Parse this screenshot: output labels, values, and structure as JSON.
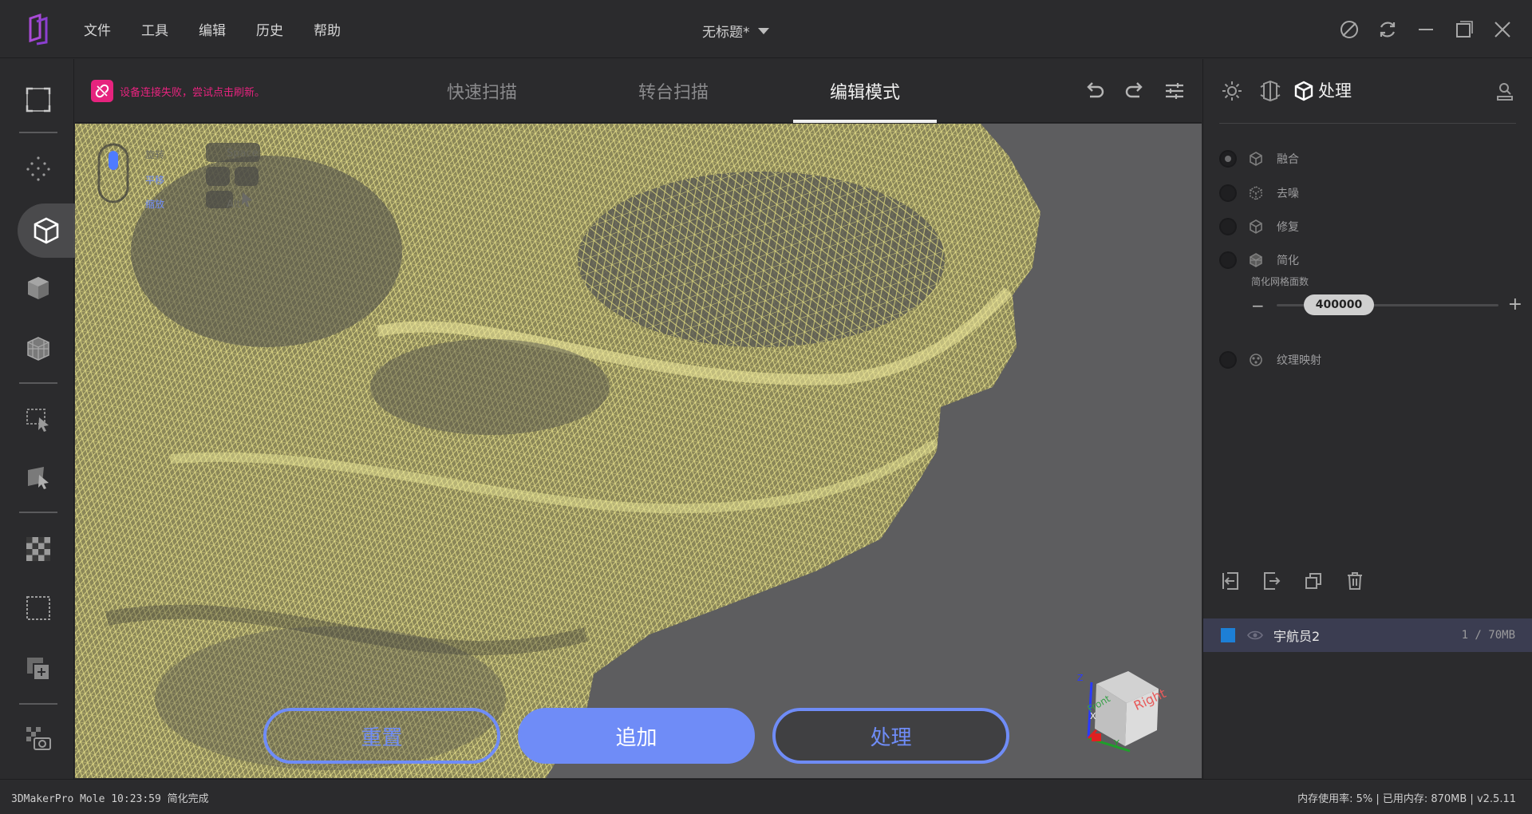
{
  "titlebar": {
    "menu": [
      "文件",
      "工具",
      "编辑",
      "历史",
      "帮助"
    ],
    "document_title": "无标题*"
  },
  "viewport_header": {
    "warning": "设备连接失败，尝试点击刷新。",
    "tabs": [
      "快速扫描",
      "转台扫描",
      "编辑模式"
    ],
    "active_tab": "编辑模式"
  },
  "hints": {
    "labels": [
      "旋转",
      "平移",
      "缩放"
    ],
    "keys": [
      "Space",
      "Alt"
    ]
  },
  "actions": {
    "reset": "重置",
    "append": "追加",
    "process": "处理"
  },
  "view_cube": {
    "front": "Front",
    "right": "Right",
    "axes": [
      "X",
      "Y",
      "Z"
    ]
  },
  "right_panel": {
    "title": "处理",
    "steps": [
      {
        "label": "融合",
        "selected": true
      },
      {
        "label": "去噪",
        "selected": false
      },
      {
        "label": "修复",
        "selected": false
      },
      {
        "label": "简化",
        "selected": false
      }
    ],
    "simplify_label": "简化网格面数",
    "simplify_value": "400000",
    "texture": {
      "label": "纹理映射",
      "selected": false
    },
    "object": {
      "name": "宇航员2",
      "size": "1 / 70MB",
      "color": "#1d7fd6"
    }
  },
  "statusbar": {
    "left": "3DMakerPro Mole  10:23:59 简化完成",
    "right": "内存使用率: 5% | 已用内存: 870MB | v2.5.11"
  },
  "colors": {
    "accent": "#6f8cf7",
    "warning": "#e6237e",
    "mesh": "#d6d27a"
  }
}
